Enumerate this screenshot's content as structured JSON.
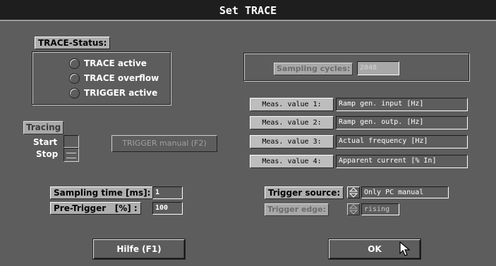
{
  "window": {
    "title": "Set TRACE"
  },
  "status": {
    "label": "TRACE-Status:",
    "items": [
      "TRACE active",
      "TRACE overflow",
      "TRIGGER active"
    ]
  },
  "sampling_cycles": {
    "label": "Sampling cycles:",
    "value": "2048"
  },
  "measurements": [
    {
      "button": "Meas. value 1:",
      "value": "Ramp gen. input [Hz]"
    },
    {
      "button": "Meas. value 2:",
      "value": "Ramp gen. outp. [Hz]"
    },
    {
      "button": "Meas. value 3:",
      "value": "Actual frequency [Hz]"
    },
    {
      "button": "Meas. value 4:",
      "value": "Apparent current [% In]"
    }
  ],
  "tracing": {
    "label": "Tracing",
    "start_label": "Start",
    "stop_label": "Stop",
    "trigger_manual": "TRIGGER manual (F2)"
  },
  "sampling_time": {
    "label": "Sampling time [ms]:",
    "value": "1"
  },
  "pre_trigger": {
    "label": "Pre-Trigger   [%] :",
    "value": "100"
  },
  "trigger_source": {
    "label": "Trigger source:",
    "value": "Only PC manual"
  },
  "trigger_edge": {
    "label": "Trigger edge:",
    "value": "rising"
  },
  "buttons": {
    "help": "Hilfe (F1)",
    "ok": "OK"
  },
  "icons": {
    "radio": "radio-button-icon",
    "spin": "spin-arrows-icon",
    "cursor": "mouse-pointer-icon"
  },
  "colors": {
    "background": "#5d5d5d",
    "titlebar": "#1e1e1e",
    "button_face": "#bdbdbd"
  }
}
